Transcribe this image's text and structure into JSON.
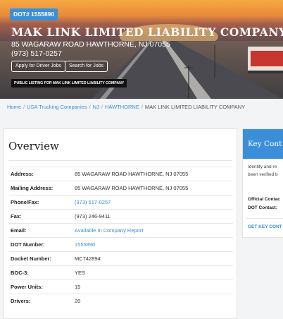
{
  "header": {
    "dot_badge": "DOT# 1555890",
    "company_name": "MAK LINK LIMITED LIABILITY COMPANY",
    "address": "85 WAGARAW ROAD HAWTHORNE, NJ 07055",
    "phone": "(973) 517-0257",
    "buttons": {
      "apply": "Apply for Driver Jobs",
      "search": "Search for Jobs"
    },
    "public_label": "PUBLIC LISTING FOR MAK LINK LIMITED LIABILITY COMPANY"
  },
  "breadcrumb": {
    "home": "Home",
    "companies": "USA Trucking Companies",
    "state": "NJ",
    "city": "HAWTHORNE",
    "current": "MAK LINK LIMITED LIABILITY COMPANY"
  },
  "overview": {
    "title": "Overview",
    "rows": [
      {
        "label": "Address:",
        "value": "85 WAGARAW ROAD HAWTHORNE, NJ 07055"
      },
      {
        "label": "Mailing Address:",
        "value": "85 WAGARAW ROAD HAWTHORNE, NJ 07055"
      },
      {
        "label": "Phone/Fax:",
        "value": "(973) 517-0257"
      },
      {
        "label": "Fax:",
        "value": "(973) 246-9411"
      },
      {
        "label": "Email:",
        "value": "Available In Company Report"
      },
      {
        "label": "DOT Number:",
        "value": "1555890"
      },
      {
        "label": "Docket Number:",
        "value": "MC742894"
      },
      {
        "label": "BOC-3:",
        "value": "YES"
      },
      {
        "label": "Power Units:",
        "value": "15"
      },
      {
        "label": "Drivers:",
        "value": "20"
      }
    ]
  },
  "key_contacts": {
    "title": "Key Cont",
    "text_line1": "Identify and re",
    "text_line2": "been verified b",
    "official_contact": "Official Contac",
    "dot_contact": "DOT Contact:",
    "link": "GET KEY CONT"
  },
  "colors": {
    "accent": "#3b8fd9",
    "badge_bg": "#3b8fd9"
  }
}
